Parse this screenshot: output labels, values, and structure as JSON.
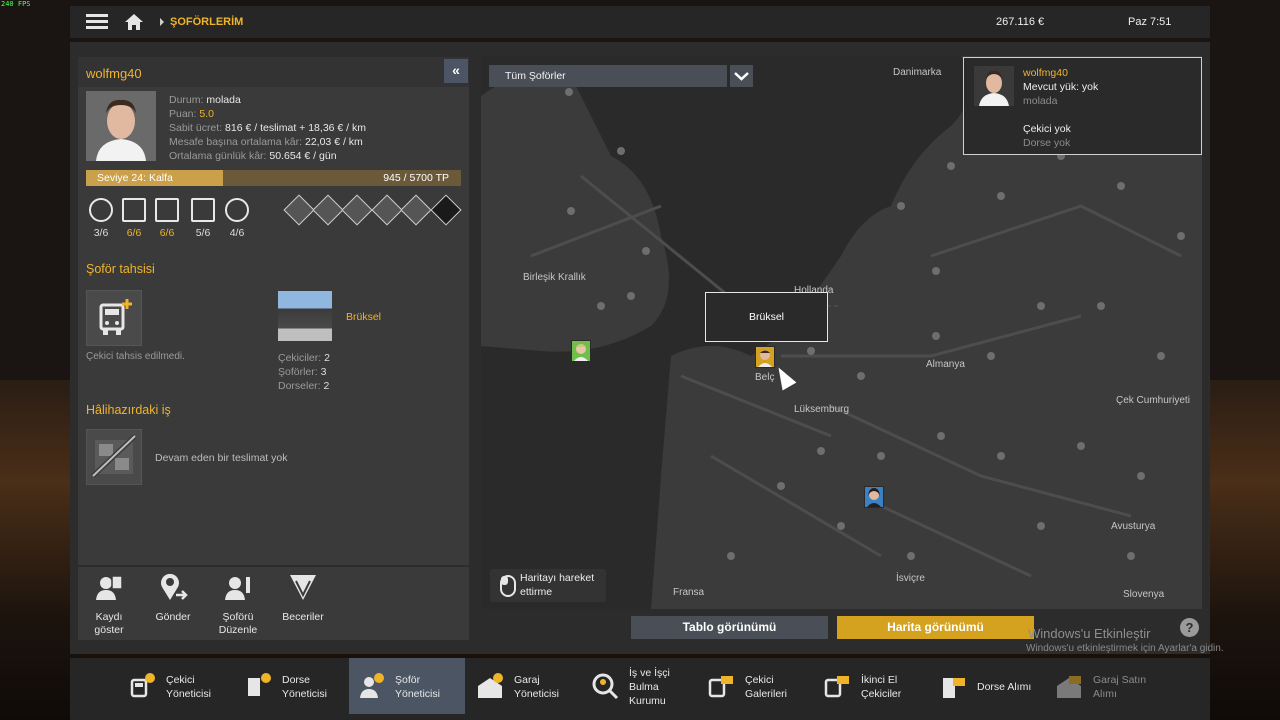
{
  "fps": "240 FPS",
  "topbar": {
    "breadcrumb": "ŞOFÖRLERİM",
    "money": "267.116 €",
    "time": "Paz 7:51"
  },
  "driver": {
    "name": "wolfmg40",
    "status_label": "Durum:",
    "status_value": "molada",
    "rating_label": "Puan:",
    "rating_value": "5.0",
    "fixed_label": "Sabit ücret:",
    "fixed_value": "816 € / teslimat + 18,36 € / km",
    "perkm_label": "Mesafe başına ortalama kâr:",
    "perkm_value": "22,03 € / km",
    "daily_label": "Ortalama günlük kâr:",
    "daily_value": "50.654 € / gün",
    "level_text": "Seviye 24: Kalfa",
    "xp_text": "945 / 5700 TP",
    "level_progress": 0.166
  },
  "skills": [
    {
      "icon": "map-pin-icon",
      "value": "3/6",
      "color": "#e8e8e8"
    },
    {
      "icon": "cargo-bonus-icon",
      "value": "6/6",
      "color": "#f0b429"
    },
    {
      "icon": "crane-icon",
      "value": "6/6",
      "color": "#f0b429"
    },
    {
      "icon": "clock-icon",
      "value": "5/6",
      "color": "#e8e8e8"
    },
    {
      "icon": "eco-icon",
      "value": "4/6",
      "color": "#e8e8e8"
    }
  ],
  "truck_section": {
    "title": "Şoför tahsisi",
    "no_truck": "Çekici tahsis edilmedi.",
    "garage_city": "Brüksel",
    "trucks_label": "Çekiciler:",
    "trucks_value": "2",
    "drivers_label": "Şoförler:",
    "drivers_value": "3",
    "trailers_label": "Dorseler:",
    "trailers_value": "2"
  },
  "job_section": {
    "title": "Hâlihazırdaki iş",
    "empty_text": "Devam eden bir teslimat yok"
  },
  "actions": [
    {
      "line1": "Kaydı",
      "line2": "göster"
    },
    {
      "line1": "Gönder",
      "line2": ""
    },
    {
      "line1": "Şoförü",
      "line2": "Düzenle"
    },
    {
      "line1": "Beceriler",
      "line2": ""
    }
  ],
  "map": {
    "filter": "Tüm Şoförler",
    "labels": {
      "denmark": "Danimarka",
      "uk": "Birleşik Krallık",
      "netherlands": "Hollanda",
      "germany": "Almanya",
      "luxembourg": "Lüksemburg",
      "czech": "Çek Cumhuriyeti",
      "austria": "Avusturya",
      "switzerland": "İsviçre",
      "france": "Fransa",
      "slovenia": "Slovenya",
      "belgium": "Belç"
    },
    "tooltip": "Brüksel",
    "hint_line1": "Haritayı hareket",
    "hint_line2": "ettirme"
  },
  "info_card": {
    "name": "wolfmg40",
    "cargo": "Mevcut yük: yok",
    "status": "molada",
    "truck": "Çekici yok",
    "trailer": "Dorse yok"
  },
  "view_buttons": {
    "table": "Tablo görünümü",
    "map": "Harita görünümü"
  },
  "watermark": {
    "title": "Windows'u Etkinleştir",
    "subtitle": "Windows'u etkinleştirmek için Ayarlar'a gidin."
  },
  "help": "?",
  "bottom_nav": [
    {
      "line1": "Çekici",
      "line2": "Yöneticisi",
      "line3": ""
    },
    {
      "line1": "Dorse",
      "line2": "Yöneticisi",
      "line3": ""
    },
    {
      "line1": "Şoför",
      "line2": "Yöneticisi",
      "line3": ""
    },
    {
      "line1": "Garaj",
      "line2": "Yöneticisi",
      "line3": ""
    },
    {
      "line1": "İş ve İşçi",
      "line2": "Bulma",
      "line3": "Kurumu"
    },
    {
      "line1": "Çekici",
      "line2": "Galerileri",
      "line3": ""
    },
    {
      "line1": "İkinci El",
      "line2": "Çekiciler",
      "line3": ""
    },
    {
      "line1": "Dorse Alımı",
      "line2": "",
      "line3": ""
    },
    {
      "line1": "Garaj Satın",
      "line2": "Alımı",
      "line3": ""
    }
  ]
}
